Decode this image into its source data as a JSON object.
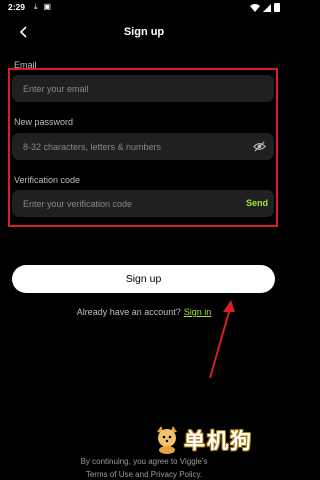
{
  "status_bar": {
    "time": "2:29",
    "left_icons": [
      "download-icon",
      "notification-icon"
    ],
    "right_icons": [
      "wifi-icon",
      "signal-icon",
      "battery-icon"
    ]
  },
  "header": {
    "title": "Sign up",
    "back_icon": "chevron-left-icon"
  },
  "form": {
    "email": {
      "label": "Email",
      "placeholder": "Enter your email",
      "value": ""
    },
    "password": {
      "label": "New password",
      "placeholder": "8-32 characters, letters & numbers",
      "value": "",
      "toggle_icon": "eye-off-icon"
    },
    "verification": {
      "label": "Verification code",
      "placeholder": "Enter your verification code",
      "value": "",
      "send_label": "Send"
    },
    "highlight_color": "#d61f26"
  },
  "actions": {
    "signup_label": "Sign up",
    "signin_prompt": "Already have an account?",
    "signin_link": "Sign in"
  },
  "footer": {
    "terms_line1": "By continuing, you agree to Viggle's",
    "terms_line2": "Terms of Use and Privacy Policy."
  },
  "watermark": {
    "text": "单机狗"
  },
  "colors": {
    "accent": "#a3e635",
    "background": "#000000",
    "field_bg": "#202022",
    "annotation": "#d61f26"
  }
}
